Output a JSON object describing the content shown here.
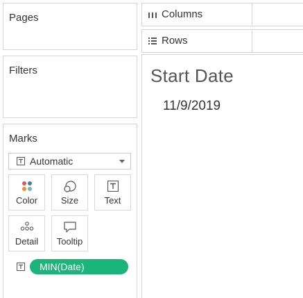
{
  "pages": {
    "title": "Pages"
  },
  "filters": {
    "title": "Filters"
  },
  "marks": {
    "title": "Marks",
    "mark_type": "Automatic",
    "buttons": [
      {
        "label": "Color",
        "icon": "color-dots-icon"
      },
      {
        "label": "Size",
        "icon": "size-icon"
      },
      {
        "label": "Text",
        "icon": "text-icon"
      },
      {
        "label": "Detail",
        "icon": "detail-icon"
      },
      {
        "label": "Tooltip",
        "icon": "tooltip-icon"
      }
    ],
    "pill": {
      "label": "MIN(Date)",
      "color": "#1bb57c"
    }
  },
  "shelves": {
    "columns": {
      "label": "Columns",
      "icon": "columns-icon"
    },
    "rows": {
      "label": "Rows",
      "icon": "rows-icon"
    }
  },
  "view": {
    "title": "Start Date",
    "value": "11/9/2019"
  }
}
